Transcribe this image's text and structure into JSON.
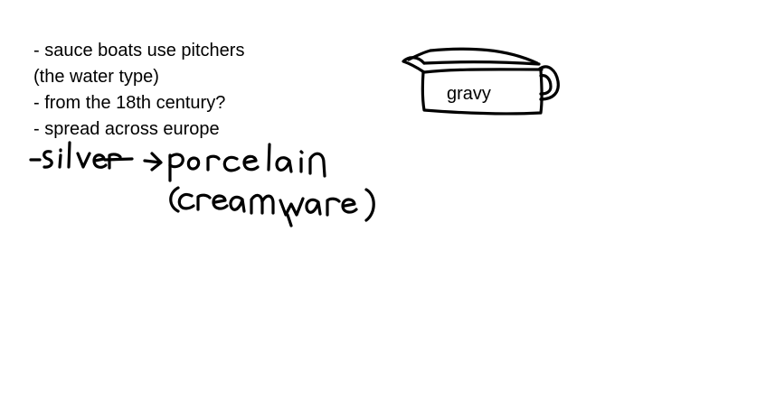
{
  "notes": [
    "- sauce boats use pitchers",
    "(the water type)",
    "- from the 18th century?",
    "- spread across europe"
  ],
  "handwriting": {
    "line1": "-silver → porcelain",
    "line2": "(creamware)"
  },
  "sketch": {
    "label": "gravy"
  }
}
